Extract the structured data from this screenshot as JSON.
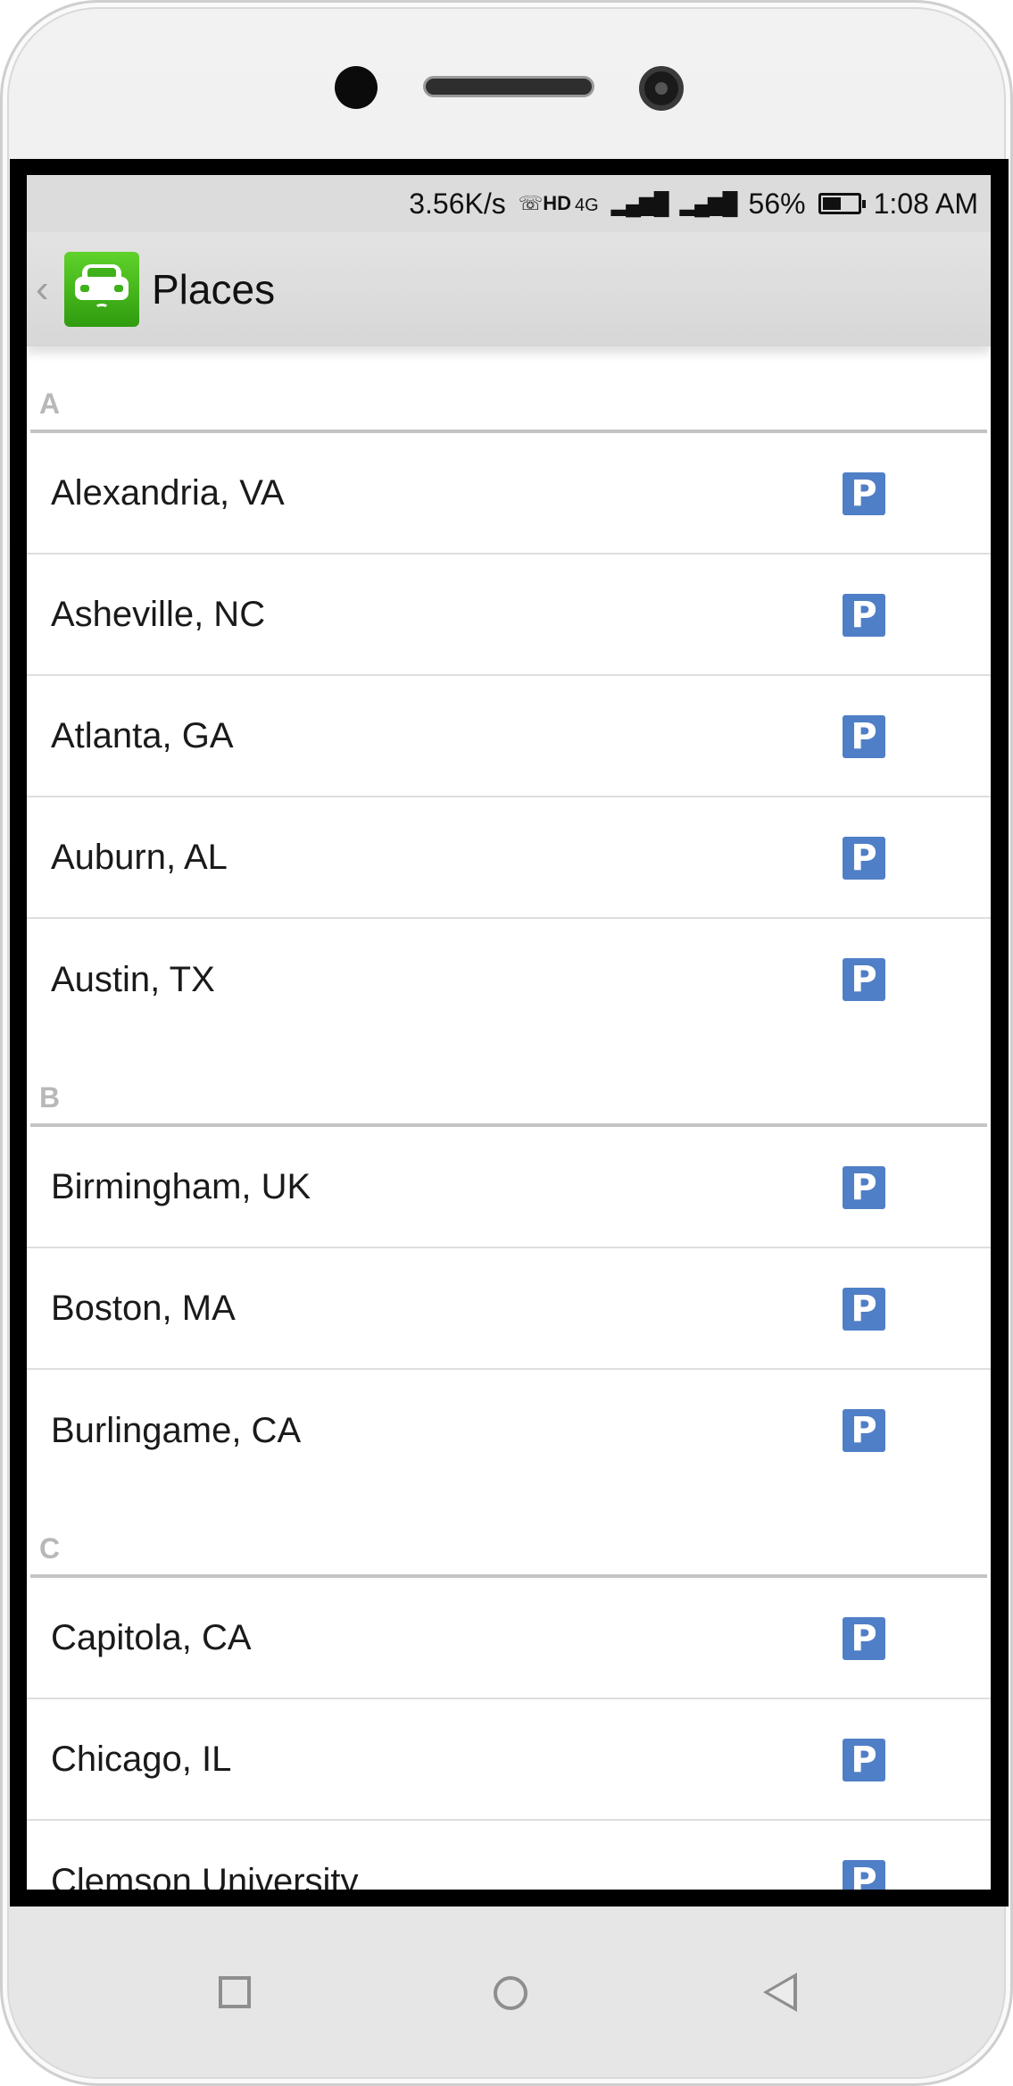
{
  "status_bar": {
    "network_speed": "3.56K/s",
    "hd_label": "HD",
    "network_type": "4G",
    "battery_percent": "56%",
    "time": "1:08 AM"
  },
  "app_bar": {
    "title": "Places"
  },
  "sections": [
    {
      "letter": "A",
      "items": [
        {
          "name": "Alexandria, VA",
          "badge": "P"
        },
        {
          "name": "Asheville, NC",
          "badge": "P"
        },
        {
          "name": "Atlanta, GA",
          "badge": "P"
        },
        {
          "name": "Auburn, AL",
          "badge": "P"
        },
        {
          "name": "Austin, TX",
          "badge": "P"
        }
      ]
    },
    {
      "letter": "B",
      "items": [
        {
          "name": "Birmingham, UK",
          "badge": "P"
        },
        {
          "name": "Boston, MA",
          "badge": "P"
        },
        {
          "name": "Burlingame, CA",
          "badge": "P"
        }
      ]
    },
    {
      "letter": "C",
      "items": [
        {
          "name": "Capitola, CA",
          "badge": "P"
        },
        {
          "name": "Chicago, IL",
          "badge": "P"
        },
        {
          "name": "Clemson University",
          "badge": "P"
        }
      ]
    }
  ],
  "colors": {
    "parking_badge": "#4f7fc6",
    "app_icon_green": "#3fb11a",
    "section_letter": "#b8b8b8"
  }
}
